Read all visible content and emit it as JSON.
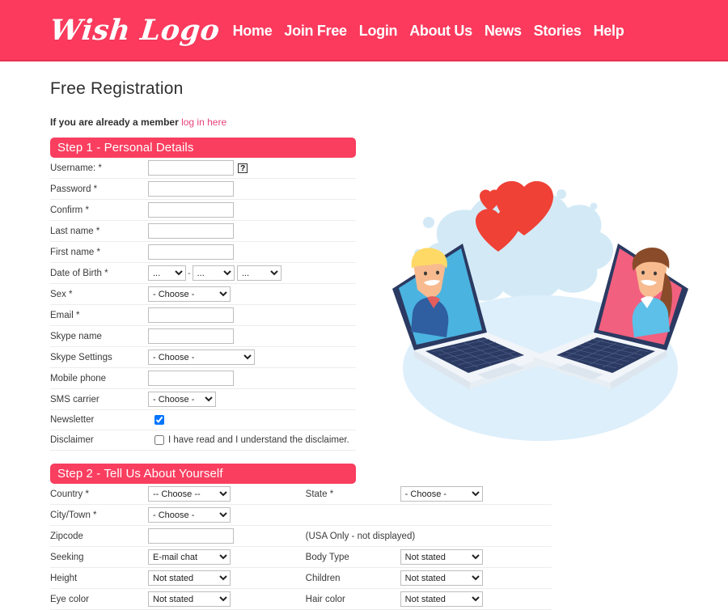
{
  "header": {
    "logo_text": "Wish Logo",
    "nav": [
      {
        "label": "Home"
      },
      {
        "label": "Join Free"
      },
      {
        "label": "Login"
      },
      {
        "label": "About Us"
      },
      {
        "label": "News"
      },
      {
        "label": "Stories"
      },
      {
        "label": "Help"
      }
    ],
    "background_color": "#fb3a5d"
  },
  "page": {
    "title": "Free Registration",
    "member_note_prefix": "If you are already a member ",
    "member_note_link": "log in here"
  },
  "step1": {
    "header": "Step 1 - Personal Details",
    "rows": {
      "username_label": "Username: *",
      "username_value": "",
      "username_help": "?",
      "password_label": "Password *",
      "password_value": "",
      "confirm_label": "Confirm *",
      "confirm_value": "",
      "lastname_label": "Last name *",
      "lastname_value": "",
      "firstname_label": "First name *",
      "firstname_value": "",
      "dob_label": "Date of Birth *",
      "dob_day": "...",
      "dob_month": "...",
      "dob_year": "...",
      "dob_separator": "-",
      "sex_label": "Sex *",
      "sex_value": "- Choose -",
      "email_label": "Email *",
      "email_value": "",
      "skypename_label": "Skype name",
      "skypename_value": "",
      "skypesettings_label": "Skype Settings",
      "skypesettings_value": "- Choose -",
      "mobile_label": "Mobile phone",
      "mobile_value": "",
      "sms_label": "SMS carrier",
      "sms_value": "- Choose -",
      "newsletter_label": "Newsletter",
      "newsletter_checked": true,
      "disclaimer_label": "Disclaimer",
      "disclaimer_text": "I have read and I understand the disclaimer.",
      "disclaimer_checked": false
    }
  },
  "step2": {
    "header": "Step 2 - Tell Us About Yourself",
    "rows": [
      {
        "left_label": "Country *",
        "left_value": "-- Choose --",
        "right_label": "State *",
        "right_value": "- Choose -"
      },
      {
        "left_label": "City/Town *",
        "left_value": "- Choose -",
        "right_label": "",
        "right_value": ""
      },
      {
        "left_label": "Zipcode",
        "left_value": "",
        "right_label": "",
        "right_note": "(USA Only - not displayed)"
      },
      {
        "left_label": "Seeking",
        "left_value": "E-mail chat",
        "right_label": "Body Type",
        "right_value": "Not stated"
      },
      {
        "left_label": "Height",
        "left_value": "Not stated",
        "right_label": "Children",
        "right_value": "Not stated"
      },
      {
        "left_label": "Eye color",
        "left_value": "Not stated",
        "right_label": "Hair color",
        "right_value": "Not stated"
      }
    ]
  },
  "illustration": {
    "name": "online-dating-laptops-hearts",
    "colors": {
      "splash": "#cfe9f5",
      "floor": "#d8eef8",
      "heart": "#ef4136",
      "laptop_body": "#f2f5f8",
      "laptop_frame": "#2b3a62",
      "left_screen": "#4bb3e0",
      "right_screen": "#f2607f",
      "hair_blond": "#ffd966",
      "hair_brown": "#8a4b2a",
      "skin": "#f7bb8f"
    }
  }
}
